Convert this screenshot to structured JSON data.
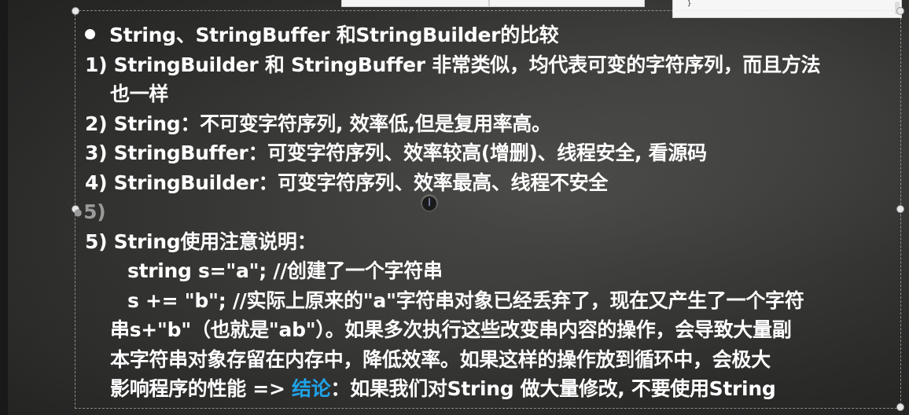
{
  "slide": {
    "bullet_title": "String、StringBuffer 和StringBuilder的比较",
    "item1_line1": "1) StringBuilder 和 StringBuffer 非常类似，均代表可变的字符序列，而且方法",
    "item1_line2": "也一样",
    "item2": "2) String：不可变字符序列, 效率低,但是复用率高。",
    "item3": "3) StringBuffer：可变字符序列、效率较高(增删)、线程安全, 看源码",
    "item4": "4) StringBuilder：可变字符序列、效率最高、线程不安全",
    "item5_placeholder": "5)",
    "item5_title": "5) String使用注意说明：",
    "code_line1": "string s=\"a\"; //创建了一个字符串",
    "code_line2": "s += \"b\"; //实际上原来的\"a\"字符串对象已经丢弃了，现在又产生了一个字符",
    "para_line1": "串s+\"b\"（也就是\"ab\"）。如果多次执行这些改变串内容的操作，会导致大量副",
    "para_line2": "本字符串对象存留在内存中，降低效率。如果这样的操作放到循环中，会极大",
    "para_line3_prefix": "影响程序的性能 => ",
    "para_line3_accent": "结论",
    "para_line3_suffix": "：如果我们对String 做大量修改, 不要使用String"
  },
  "thumbnail": {
    "code_snippet": "}"
  },
  "colors": {
    "text": "#ffffff",
    "accent": "#1fa3e8",
    "dim": "#9a9a9a",
    "board": "#3a3a38"
  },
  "icons": {
    "cursor": "text-cursor-icon",
    "bullet": "bullet-dot-icon"
  }
}
